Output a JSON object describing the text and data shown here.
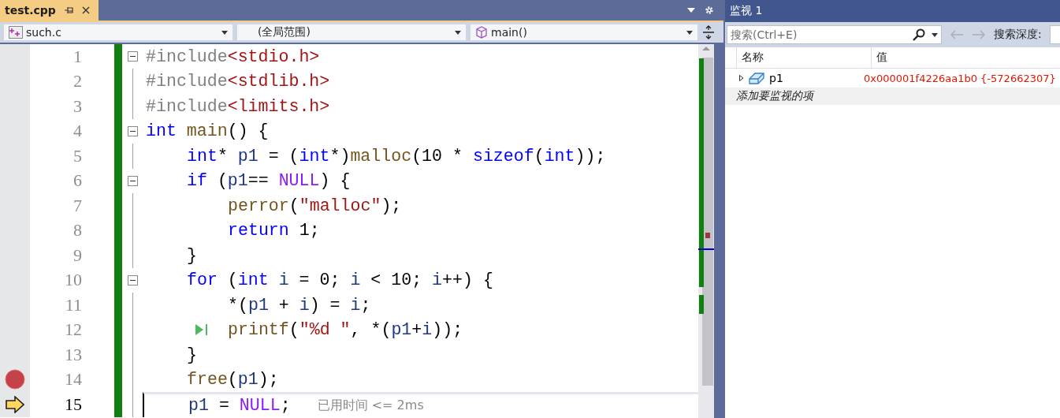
{
  "editor_tab": {
    "title": "test.cpp"
  },
  "nav": {
    "file": "such.c",
    "scope": "(全局范围)",
    "member": "main()"
  },
  "code_lines": [
    {
      "number": "1",
      "fold": true,
      "breakpoint": false,
      "current": false,
      "step": false,
      "tokens": [
        {
          "text": "#include",
          "kind": "pre"
        },
        {
          "text": "<stdio.h>",
          "kind": "str"
        }
      ]
    },
    {
      "number": "2",
      "fold": false,
      "breakpoint": false,
      "current": false,
      "step": false,
      "tokens": [
        {
          "text": "#include",
          "kind": "pre"
        },
        {
          "text": "<stdlib.h>",
          "kind": "str"
        }
      ]
    },
    {
      "number": "3",
      "fold": false,
      "breakpoint": false,
      "current": false,
      "step": false,
      "tokens": [
        {
          "text": "#include",
          "kind": "pre"
        },
        {
          "text": "<limits.h>",
          "kind": "str"
        }
      ]
    },
    {
      "number": "4",
      "fold": true,
      "breakpoint": false,
      "current": false,
      "step": false,
      "tokens": [
        {
          "text": "int",
          "kind": "kw"
        },
        {
          "text": " main",
          "kind": "fn"
        },
        {
          "text": "() {",
          "kind": "plain"
        }
      ],
      "children": [
        {
          "number": "5",
          "fold": false,
          "breakpoint": false,
          "current": false,
          "step": false,
          "tokens": [
            {
              "text": "int",
              "kind": "kw"
            },
            {
              "text": "* ",
              "kind": "plain"
            },
            {
              "text": "p1",
              "kind": "var"
            },
            {
              "text": " = (",
              "kind": "plain"
            },
            {
              "text": "int",
              "kind": "kw"
            },
            {
              "text": "*)",
              "kind": "plain"
            },
            {
              "text": "malloc",
              "kind": "fn"
            },
            {
              "text": "(10 * ",
              "kind": "plain"
            },
            {
              "text": "sizeof",
              "kind": "kw"
            },
            {
              "text": "(",
              "kind": "plain"
            },
            {
              "text": "int",
              "kind": "kw"
            },
            {
              "text": "));",
              "kind": "plain"
            }
          ]
        },
        {
          "number": "6",
          "fold": true,
          "breakpoint": false,
          "current": false,
          "step": false,
          "tokens": [
            {
              "text": "if",
              "kind": "kw"
            },
            {
              "text": " (",
              "kind": "plain"
            },
            {
              "text": "p1",
              "kind": "var"
            },
            {
              "text": "== ",
              "kind": "plain"
            },
            {
              "text": "NULL",
              "kind": "macro"
            },
            {
              "text": ") {",
              "kind": "plain"
            }
          ],
          "children": [
            {
              "number": "7",
              "fold": false,
              "breakpoint": false,
              "current": false,
              "step": false,
              "tokens": [
                {
                  "text": "perror",
                  "kind": "fn"
                },
                {
                  "text": "(",
                  "kind": "plain"
                },
                {
                  "text": "\"malloc\"",
                  "kind": "str"
                },
                {
                  "text": ");",
                  "kind": "plain"
                }
              ]
            },
            {
              "number": "8",
              "fold": false,
              "breakpoint": false,
              "current": false,
              "step": false,
              "tokens": [
                {
                  "text": "return",
                  "kind": "kw"
                },
                {
                  "text": " 1;",
                  "kind": "plain"
                }
              ]
            }
          ]
        },
        {
          "number": "9",
          "fold": false,
          "breakpoint": false,
          "current": false,
          "step": false,
          "tokens": [
            {
              "text": "}",
              "kind": "plain"
            }
          ]
        },
        {
          "number": "10",
          "fold": true,
          "breakpoint": false,
          "current": false,
          "step": false,
          "tokens": [
            {
              "text": "for",
              "kind": "kw"
            },
            {
              "text": " (",
              "kind": "plain"
            },
            {
              "text": "int",
              "kind": "kw"
            },
            {
              "text": " i",
              "kind": "var"
            },
            {
              "text": " = 0; ",
              "kind": "plain"
            },
            {
              "text": "i",
              "kind": "var"
            },
            {
              "text": " < 10; ",
              "kind": "plain"
            },
            {
              "text": "i",
              "kind": "var"
            },
            {
              "text": "++) {",
              "kind": "plain"
            }
          ],
          "children": [
            {
              "number": "11",
              "fold": false,
              "breakpoint": false,
              "current": false,
              "step": false,
              "tokens": [
                {
                  "text": "*(",
                  "kind": "plain"
                },
                {
                  "text": "p1",
                  "kind": "var"
                },
                {
                  "text": " + ",
                  "kind": "plain"
                },
                {
                  "text": "i",
                  "kind": "var"
                },
                {
                  "text": ") = ",
                  "kind": "plain"
                },
                {
                  "text": "i",
                  "kind": "var"
                },
                {
                  "text": ";",
                  "kind": "plain"
                }
              ]
            },
            {
              "number": "12",
              "fold": false,
              "breakpoint": false,
              "current": false,
              "step": true,
              "tokens": [
                {
                  "text": "printf",
                  "kind": "fn"
                },
                {
                  "text": "(",
                  "kind": "plain"
                },
                {
                  "text": "\"%d \"",
                  "kind": "str"
                },
                {
                  "text": ", *(",
                  "kind": "plain"
                },
                {
                  "text": "p1",
                  "kind": "var"
                },
                {
                  "text": "+",
                  "kind": "plain"
                },
                {
                  "text": "i",
                  "kind": "var"
                },
                {
                  "text": "));",
                  "kind": "plain"
                }
              ]
            }
          ]
        },
        {
          "number": "13",
          "fold": false,
          "breakpoint": false,
          "current": false,
          "step": false,
          "tokens": [
            {
              "text": "}",
              "kind": "plain"
            }
          ]
        },
        {
          "number": "14",
          "fold": false,
          "breakpoint": true,
          "current": false,
          "step": false,
          "tokens": [
            {
              "text": "free",
              "kind": "fn"
            },
            {
              "text": "(",
              "kind": "plain"
            },
            {
              "text": "p1",
              "kind": "var"
            },
            {
              "text": ");",
              "kind": "plain"
            }
          ]
        },
        {
          "number": "15",
          "fold": false,
          "breakpoint": false,
          "current": true,
          "step": false,
          "tokens": [
            {
              "text": "p1",
              "kind": "var"
            },
            {
              "text": " = ",
              "kind": "plain"
            },
            {
              "text": "NULL",
              "kind": "macro"
            },
            {
              "text": ";",
              "kind": "plain"
            }
          ],
          "hint": "已用时间 <= 2ms"
        }
      ]
    }
  ],
  "watch": {
    "title": "监视 1",
    "search_placeholder": "搜索(Ctrl+E)",
    "depth_label": "搜索深度:",
    "columns": [
      "名称",
      "值"
    ],
    "rows": [
      {
        "name": "p1",
        "value": "0x000001f4226aa1b0 {-572662307}",
        "changed": true
      }
    ],
    "add_item": "添加要监视的项"
  }
}
